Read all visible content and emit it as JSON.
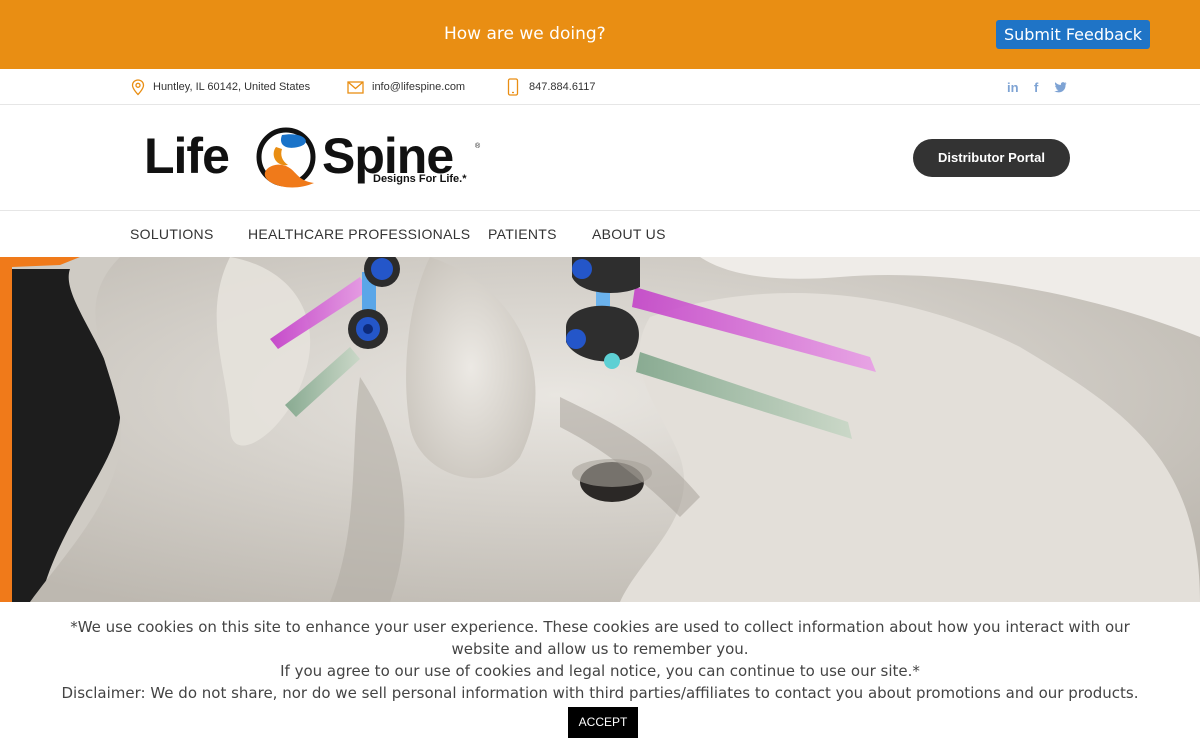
{
  "feedback_bar": {
    "prompt": "How are we doing?",
    "button_label": "Submit Feedback",
    "color": "#e98e13",
    "button_color": "#1f74c6"
  },
  "contact_bar": {
    "address": "Huntley, IL 60142, United States",
    "email": "info@lifespine.com",
    "phone": "847.884.6117",
    "icons": [
      "location-icon",
      "email-icon",
      "phone-icon"
    ],
    "social": [
      {
        "label": "in",
        "icon": "linkedin-icon"
      },
      {
        "label": "f",
        "icon": "facebook-icon"
      },
      {
        "label": "twitter",
        "icon": "twitter-icon"
      }
    ]
  },
  "header": {
    "logo": {
      "word1": "Life",
      "word2": "Spine",
      "tagline": "Designs For Life.*",
      "mark": "®"
    },
    "distributor_button": "Distributor Portal"
  },
  "nav": {
    "items": [
      {
        "label": "SOLUTIONS"
      },
      {
        "label": "HEALTHCARE PROFESSIONALS"
      },
      {
        "label": "PATIENTS"
      },
      {
        "label": "ABOUT US"
      }
    ]
  },
  "hero": {
    "description_icon": "spinal-screw-image"
  },
  "cookie_banner": {
    "line1": "*We use cookies on this site to enhance your user experience. These cookies are used to collect information about how you interact with our website and allow us to remember you.",
    "line2": "If you agree to our use of cookies and legal notice, you can continue to use our site.*",
    "line3": "Disclaimer: We do not share, nor do we sell personal information with third parties/affiliates to contact you about promotions and our products.",
    "accept_label": "ACCEPT"
  }
}
